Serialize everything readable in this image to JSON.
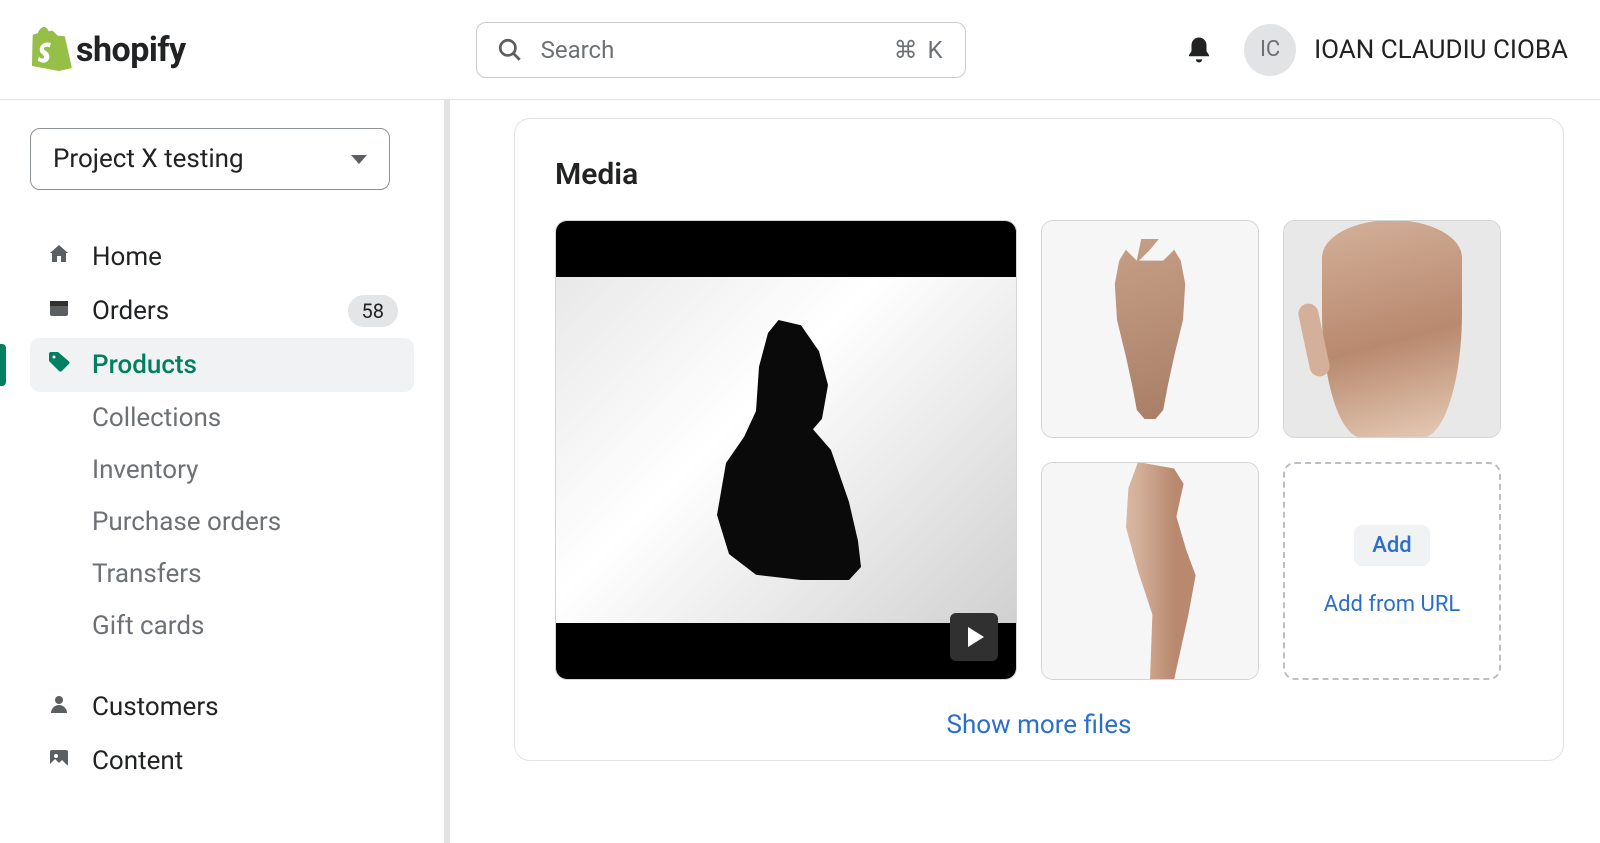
{
  "header": {
    "logo_text": "shopify",
    "search": {
      "placeholder": "Search",
      "shortcut": "⌘ K"
    },
    "avatar_initials": "IC",
    "username": "IOAN CLAUDIU CIOBA"
  },
  "sidebar": {
    "store_name": "Project X testing",
    "items": [
      {
        "label": "Home",
        "icon": "home-icon"
      },
      {
        "label": "Orders",
        "icon": "orders-icon",
        "badge": "58"
      },
      {
        "label": "Products",
        "icon": "tag-icon",
        "active": true
      },
      {
        "label": "Collections",
        "sub": true
      },
      {
        "label": "Inventory",
        "sub": true
      },
      {
        "label": "Purchase orders",
        "sub": true
      },
      {
        "label": "Transfers",
        "sub": true
      },
      {
        "label": "Gift cards",
        "sub": true
      },
      {
        "label": "Customers",
        "icon": "person-icon"
      },
      {
        "label": "Content",
        "icon": "image-icon"
      }
    ]
  },
  "main": {
    "card_title": "Media",
    "upload": {
      "add_label": "Add",
      "url_label": "Add from URL"
    },
    "show_more": "Show more files"
  }
}
